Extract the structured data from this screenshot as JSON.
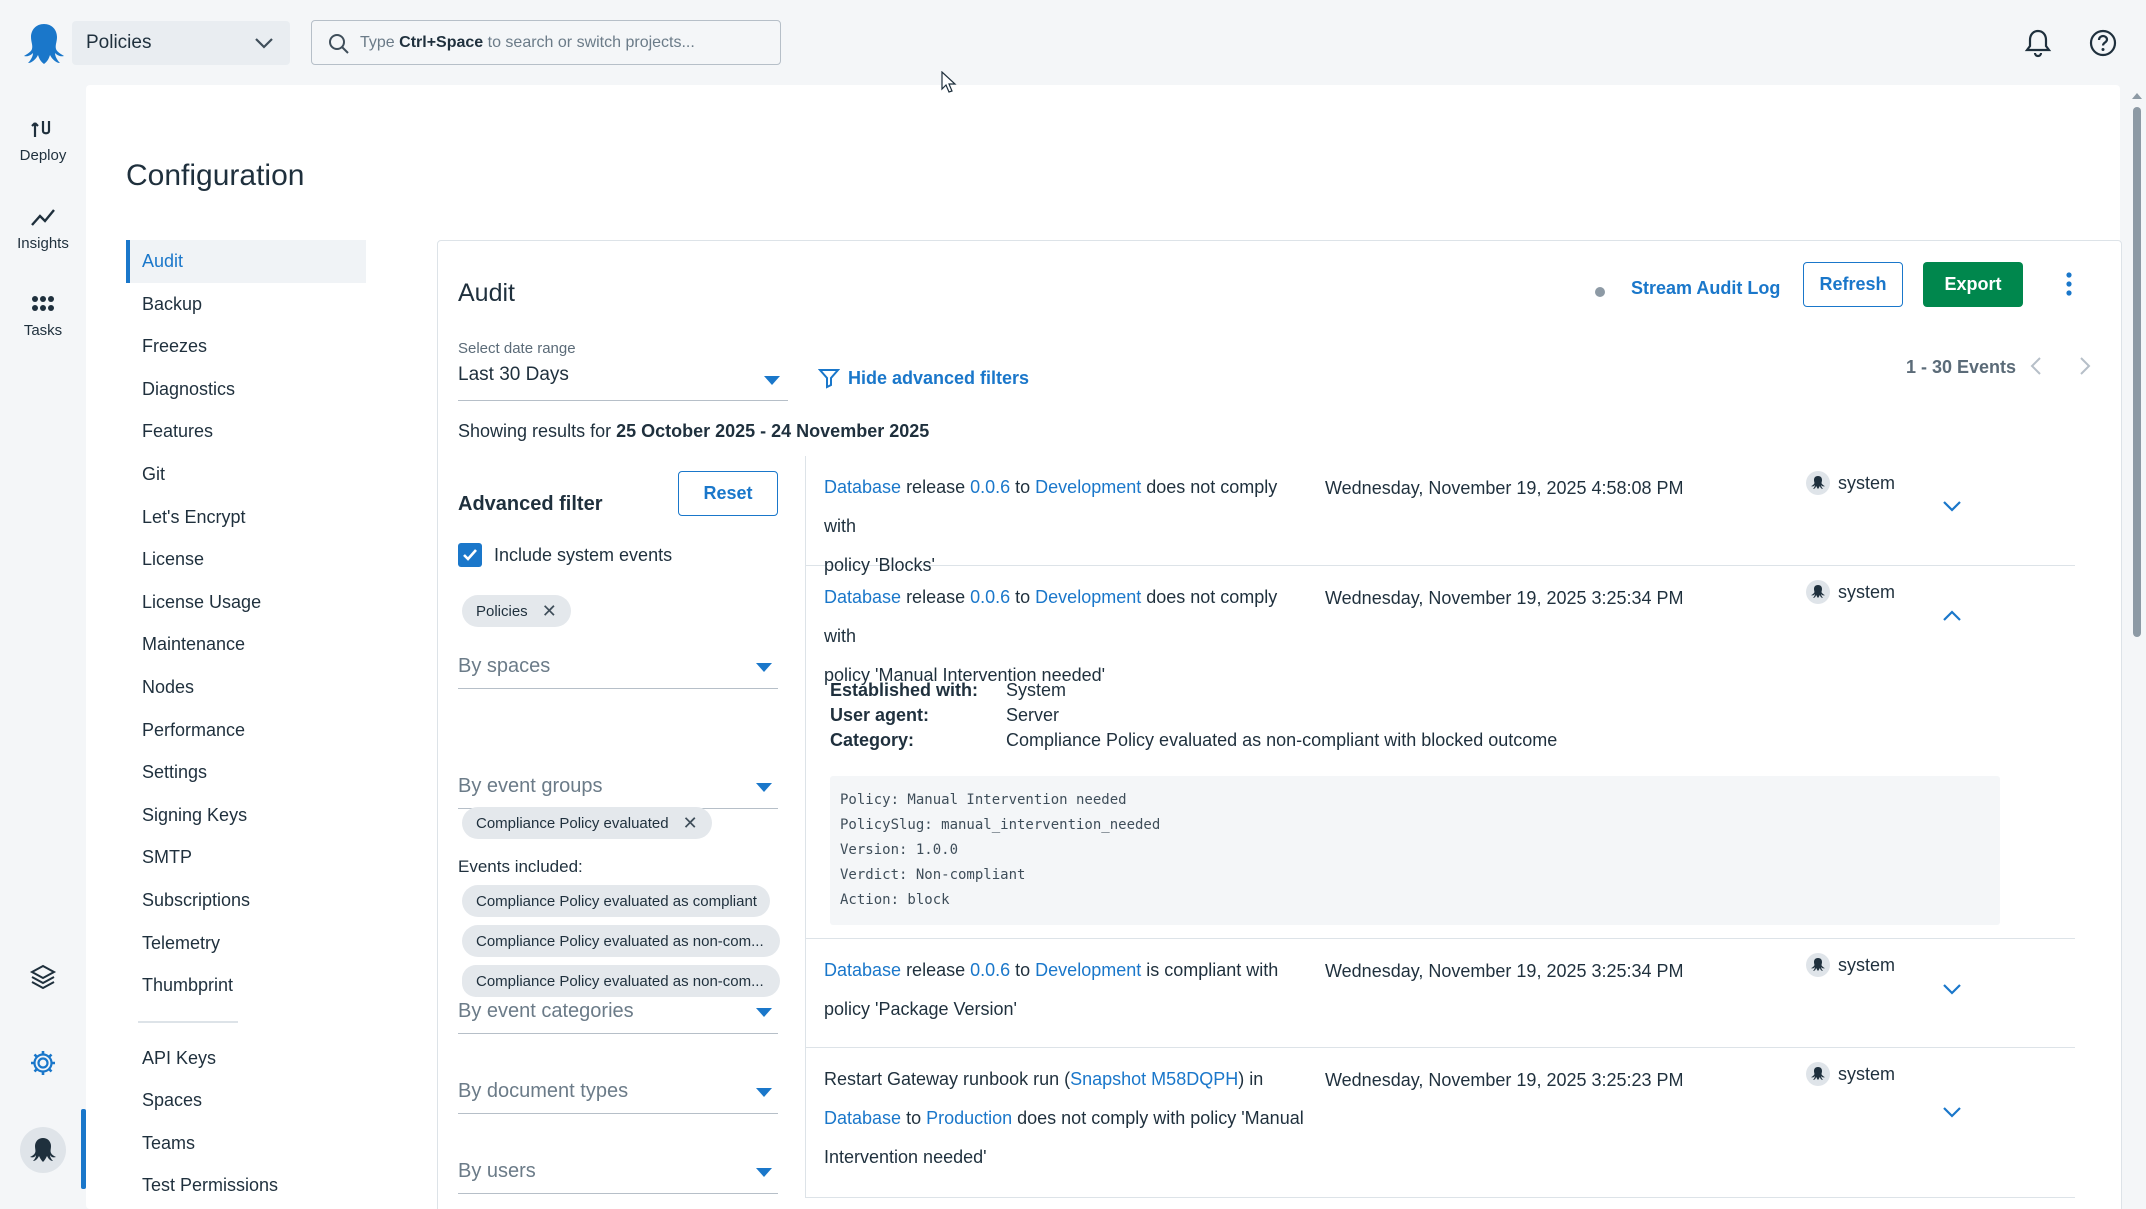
{
  "topbar": {
    "project": "Policies",
    "search_prefix": "Type ",
    "search_shortcut": "Ctrl+Space",
    "search_suffix": " to search or switch projects...",
    "icons": [
      "octopus-logo-icon",
      "chevron-down-icon",
      "search-icon",
      "bell-icon",
      "help-icon"
    ]
  },
  "rail": {
    "items": [
      {
        "label": "Deploy",
        "icon": "deploy-icon"
      },
      {
        "label": "Insights",
        "icon": "insights-icon"
      },
      {
        "label": "Tasks",
        "icon": "tasks-icon"
      }
    ],
    "bottom_icons": [
      "layers-icon",
      "gear-icon",
      "avatar-icon"
    ]
  },
  "page": {
    "title": "Configuration"
  },
  "subnav": {
    "items": [
      "Audit",
      "Backup",
      "Freezes",
      "Diagnostics",
      "Features",
      "Git",
      "Let's Encrypt",
      "License",
      "License Usage",
      "Maintenance",
      "Nodes",
      "Performance",
      "Settings",
      "Signing Keys",
      "SMTP",
      "Subscriptions",
      "Telemetry",
      "Thumbprint"
    ],
    "active": "Audit",
    "secondary": [
      "API Keys",
      "Spaces",
      "Teams",
      "Test Permissions"
    ]
  },
  "audit": {
    "title": "Audit",
    "stream_label": "Stream Audit Log",
    "refresh_label": "Refresh",
    "export_label": "Export",
    "date_range_label": "Select date range",
    "date_range_value": "Last 30 Days",
    "hide_filters_label": "Hide advanced filters",
    "events_count": "1 - 30 Events",
    "showing_prefix": "Showing results for ",
    "showing_range": "25 October 2025 - 24 November 2025"
  },
  "filters": {
    "title": "Advanced filter",
    "reset_label": "Reset",
    "include_system_label": "Include system events",
    "include_system_checked": true,
    "spaces_chip": "Policies",
    "by_spaces": "By spaces",
    "event_group_chip": "Compliance Policy evaluated",
    "by_event_groups": "By event groups",
    "events_included_label": "Events included:",
    "events_included": [
      "Compliance Policy evaluated as compliant",
      "Compliance Policy evaluated as non-com...",
      "Compliance Policy evaluated as non-com..."
    ],
    "by_event_categories": "By event categories",
    "by_document_types": "By document types",
    "by_users": "By users"
  },
  "events": [
    {
      "project": "Database",
      "w1": " release ",
      "version": "0.0.6",
      "w2": " to ",
      "environment": "Development",
      "rest1": " does not comply with",
      "rest2": "policy 'Blocks'",
      "date": "Wednesday, November 19, 2025 4:58:08 PM",
      "user": "system",
      "expanded": false
    },
    {
      "project": "Database",
      "w1": " release ",
      "version": "0.0.6",
      "w2": " to ",
      "environment": "Development",
      "rest1": " does not comply with",
      "rest2": "policy 'Manual Intervention needed'",
      "date": "Wednesday, November 19, 2025 3:25:34 PM",
      "user": "system",
      "expanded": true,
      "details": {
        "established_label": "Established with:",
        "established": "System",
        "agent_label": "User agent:",
        "agent": "Server",
        "category_label": "Category:",
        "category": "Compliance Policy evaluated as non-compliant with blocked outcome",
        "code": [
          "Policy: Manual Intervention needed",
          "PolicySlug: manual_intervention_needed",
          "Version: 1.0.0",
          "Verdict: Non-compliant",
          "Action: block"
        ]
      }
    },
    {
      "project": "Database",
      "w1": " release ",
      "version": "0.0.6",
      "w2": " to ",
      "environment": "Development",
      "rest1": " is compliant with",
      "rest2": "policy 'Package Version'",
      "date": "Wednesday, November 19, 2025 3:25:34 PM",
      "user": "system",
      "expanded": false
    },
    {
      "line1_a": "Restart Gateway runbook run (",
      "snapshot": "Snapshot M58DQPH",
      "line1_b": ") in",
      "project": "Database",
      "w2": " to ",
      "environment": "Production",
      "rest1": " does not comply with policy 'Manual",
      "rest2": "Intervention needed'",
      "date": "Wednesday, November 19, 2025 3:25:23 PM",
      "user": "system",
      "expanded": false
    }
  ],
  "colors": {
    "accent": "#1a77ca",
    "export": "#00874d",
    "background": "#f4f6f8"
  }
}
